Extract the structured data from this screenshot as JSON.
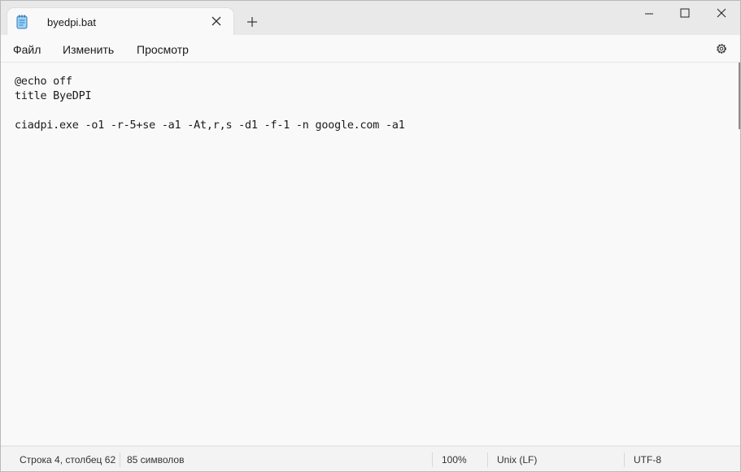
{
  "tab": {
    "title": "byedpi.bat",
    "icon": "notepad-icon"
  },
  "window_controls": {
    "minimize_icon": "minimize-icon",
    "maximize_icon": "maximize-icon",
    "close_icon": "close-icon"
  },
  "menu": {
    "file": "Файл",
    "edit": "Изменить",
    "view": "Просмотр",
    "settings_icon": "gear-icon"
  },
  "editor": {
    "lines": [
      "@echo off",
      "title ByeDPI",
      "",
      "ciadpi.exe -o1 -r-5+se -a1 -At,r,s -d1 -f-1 -n google.com -a1"
    ]
  },
  "status": {
    "position": "Строка 4, столбец 62",
    "chars": "85 символов",
    "zoom": "100%",
    "line_endings": "Unix (LF)",
    "encoding": "UTF-8"
  }
}
